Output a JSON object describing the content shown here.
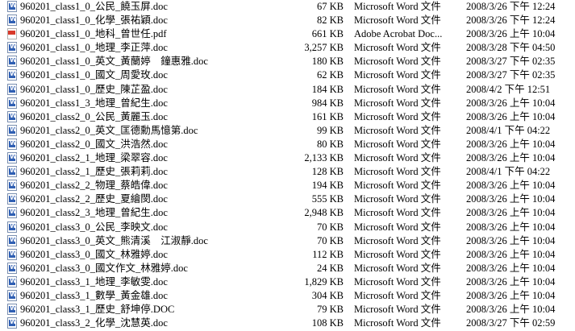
{
  "files": [
    {
      "name": "960201_class1_0_公民_饒玉屏.doc",
      "size": "67 KB",
      "type": "Microsoft Word 文件",
      "modified": "2008/3/26 下午 12:24",
      "icon": "word-doc-icon"
    },
    {
      "name": "960201_class1_0_化學_張祐穎.doc",
      "size": "82 KB",
      "type": "Microsoft Word 文件",
      "modified": "2008/3/26 下午 12:24",
      "icon": "word-doc-icon"
    },
    {
      "name": "960201_class1_0_地科_曾世任.pdf",
      "size": "661 KB",
      "type": "Adobe Acrobat Doc...",
      "modified": "2008/3/26 上午 10:04",
      "icon": "pdf-icon"
    },
    {
      "name": "960201_class1_0_地理_李正萍.doc",
      "size": "3,257 KB",
      "type": "Microsoft Word 文件",
      "modified": "2008/3/28 下午 04:50",
      "icon": "word-doc-icon"
    },
    {
      "name": "960201_class1_0_英文_黃蘭婷　鐘惠雅.doc",
      "size": "180 KB",
      "type": "Microsoft Word 文件",
      "modified": "2008/3/27 下午 02:35",
      "icon": "word-doc-icon"
    },
    {
      "name": "960201_class1_0_國文_周愛玫.doc",
      "size": "62 KB",
      "type": "Microsoft Word 文件",
      "modified": "2008/3/27 下午 02:35",
      "icon": "word-doc-icon"
    },
    {
      "name": "960201_class1_0_歷史_陳芷盈.doc",
      "size": "184 KB",
      "type": "Microsoft Word 文件",
      "modified": "2008/4/2 下午 12:51",
      "icon": "word-doc-icon"
    },
    {
      "name": "960201_class1_3_地理_曾紀生.doc",
      "size": "984 KB",
      "type": "Microsoft Word 文件",
      "modified": "2008/3/26 上午 10:04",
      "icon": "word-doc-icon"
    },
    {
      "name": "960201_class2_0_公民_黃麗玉.doc",
      "size": "161 KB",
      "type": "Microsoft Word 文件",
      "modified": "2008/3/26 上午 10:04",
      "icon": "word-doc-icon"
    },
    {
      "name": "960201_class2_0_英文_匡德勳馬憶第.doc",
      "size": "99 KB",
      "type": "Microsoft Word 文件",
      "modified": "2008/4/1 下午 04:22",
      "icon": "word-doc-icon"
    },
    {
      "name": "960201_class2_0_國文_洪浩然.doc",
      "size": "80 KB",
      "type": "Microsoft Word 文件",
      "modified": "2008/3/26 上午 10:04",
      "icon": "word-doc-icon"
    },
    {
      "name": "960201_class2_1_地理_梁翠容.doc",
      "size": "2,133 KB",
      "type": "Microsoft Word 文件",
      "modified": "2008/3/26 上午 10:04",
      "icon": "word-doc-icon"
    },
    {
      "name": "960201_class2_1_歷史_張莉莉.doc",
      "size": "128 KB",
      "type": "Microsoft Word 文件",
      "modified": "2008/4/1 下午 04:22",
      "icon": "word-doc-icon"
    },
    {
      "name": "960201_class2_2_物理_蔡皓偉.doc",
      "size": "194 KB",
      "type": "Microsoft Word 文件",
      "modified": "2008/3/26 上午 10:04",
      "icon": "word-doc-icon"
    },
    {
      "name": "960201_class2_2_歷史_夏繪閔.doc",
      "size": "555 KB",
      "type": "Microsoft Word 文件",
      "modified": "2008/3/26 上午 10:04",
      "icon": "word-doc-icon"
    },
    {
      "name": "960201_class2_3_地理_曾紀生.doc",
      "size": "2,948 KB",
      "type": "Microsoft Word 文件",
      "modified": "2008/3/26 上午 10:04",
      "icon": "word-doc-icon"
    },
    {
      "name": "960201_class3_0_公民_李映文.doc",
      "size": "70 KB",
      "type": "Microsoft Word 文件",
      "modified": "2008/3/26 上午 10:04",
      "icon": "word-doc-icon"
    },
    {
      "name": "960201_class3_0_英文_熊清溪　江淑靜.doc",
      "size": "70 KB",
      "type": "Microsoft Word 文件",
      "modified": "2008/3/26 上午 10:04",
      "icon": "word-doc-icon"
    },
    {
      "name": "960201_class3_0_國文_林雅婷.doc",
      "size": "112 KB",
      "type": "Microsoft Word 文件",
      "modified": "2008/3/26 上午 10:04",
      "icon": "word-doc-icon"
    },
    {
      "name": "960201_class3_0_國文作文_林雅婷.doc",
      "size": "24 KB",
      "type": "Microsoft Word 文件",
      "modified": "2008/3/26 上午 10:04",
      "icon": "word-doc-icon"
    },
    {
      "name": "960201_class3_1_地理_李敏雯.doc",
      "size": "1,829 KB",
      "type": "Microsoft Word 文件",
      "modified": "2008/3/26 上午 10:04",
      "icon": "word-doc-icon"
    },
    {
      "name": "960201_class3_1_數學_黃金雄.doc",
      "size": "304 KB",
      "type": "Microsoft Word 文件",
      "modified": "2008/3/26 上午 10:04",
      "icon": "word-doc-icon"
    },
    {
      "name": "960201_class3_1_歷史_舒坤停.DOC",
      "size": "79 KB",
      "type": "Microsoft Word 文件",
      "modified": "2008/3/26 上午 10:04",
      "icon": "word-doc-icon"
    },
    {
      "name": "960201_class3_2_化學_沈慧英.doc",
      "size": "108 KB",
      "type": "Microsoft Word 文件",
      "modified": "2008/3/27 下午 02:59",
      "icon": "word-doc-icon"
    }
  ]
}
